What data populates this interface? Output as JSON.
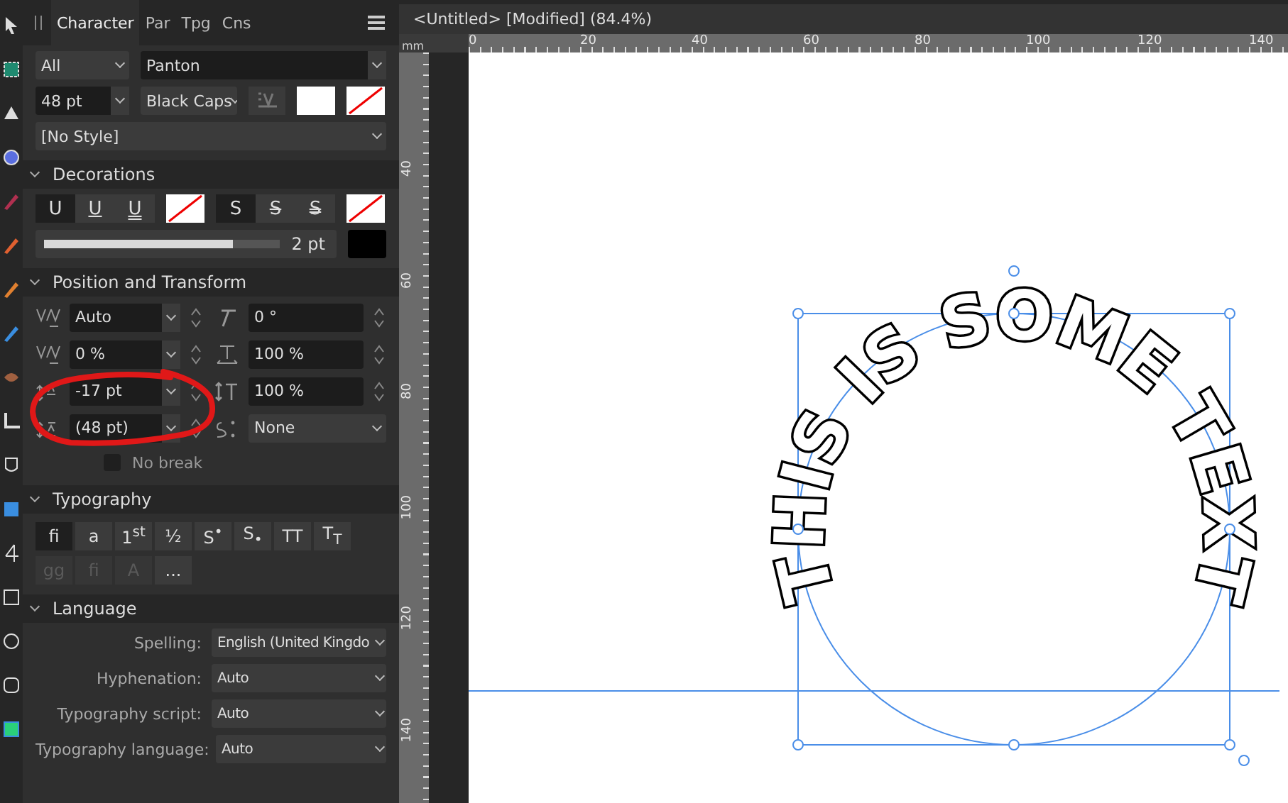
{
  "panel": {
    "tabs": [
      {
        "label": "Character",
        "selected": true
      },
      {
        "label": "Par",
        "selected": false
      },
      {
        "label": "Tpg",
        "selected": false
      },
      {
        "label": "Cns",
        "selected": false
      }
    ],
    "character": {
      "scope": "All",
      "font": "Panton",
      "size": "48 pt",
      "weight": "Black Caps",
      "style": "[No Style]"
    },
    "decorations": {
      "title": "Decorations",
      "underline": [
        {
          "label": "U",
          "kind": "none",
          "selected": true
        },
        {
          "label": "U",
          "kind": "single",
          "selected": false
        },
        {
          "label": "U",
          "kind": "double",
          "selected": false
        }
      ],
      "strike": [
        {
          "label": "S",
          "kind": "none",
          "selected": true
        },
        {
          "label": "S",
          "kind": "single",
          "selected": false
        },
        {
          "label": "S",
          "kind": "double",
          "selected": false
        }
      ],
      "weight": {
        "level": 0.8,
        "reading": "2 pt"
      }
    },
    "position": {
      "title": "Position and Transform",
      "fields": [
        {
          "kind": "kerning",
          "value": "Auto"
        },
        {
          "kind": "shear",
          "value": "0 °"
        },
        {
          "kind": "tracking",
          "value": "0 %"
        },
        {
          "kind": "hscale",
          "value": "100 %"
        },
        {
          "kind": "baseline",
          "value": "-17 pt"
        },
        {
          "kind": "vscale",
          "value": "100 %"
        },
        {
          "kind": "leading",
          "value": "(48 pt)"
        },
        {
          "kind": "script",
          "value": "None"
        }
      ],
      "no_break": {
        "label": "No break",
        "checked": false
      }
    },
    "typography": {
      "title": "Typography",
      "buttons": [
        {
          "label": "fi",
          "selected": true,
          "disabled": false
        },
        {
          "label": "a",
          "selected": false,
          "disabled": false
        },
        {
          "label": "1$^{st}$",
          "selected": false,
          "disabled": false
        },
        {
          "label": "½",
          "selected": false,
          "disabled": false
        },
        {
          "label": "S$^{•}$",
          "selected": false,
          "disabled": false
        },
        {
          "label": "S$_{•}$",
          "selected": false,
          "disabled": false
        },
        {
          "label": "TT",
          "selected": false,
          "disabled": false
        },
        {
          "label": "T$_{T}$",
          "selected": false,
          "disabled": false
        },
        {
          "label": "gg",
          "selected": false,
          "disabled": true
        },
        {
          "label": "fi",
          "selected": false,
          "disabled": true
        },
        {
          "label": "A",
          "selected": false,
          "disabled": true
        },
        {
          "label": "...",
          "selected": false,
          "disabled": false
        }
      ]
    },
    "language": {
      "title": "Language",
      "rows": [
        {
          "label": "Spelling:",
          "value": "English (United Kingdo"
        },
        {
          "label": "Hyphenation:",
          "value": "Auto"
        },
        {
          "label": "Typography script:",
          "value": "Auto"
        },
        {
          "label": "Typography language:",
          "value": "Auto"
        }
      ]
    }
  },
  "document": {
    "title": "<Untitled> [Modified] (84.4%)",
    "unit": "mm",
    "hruler": [
      "0",
      "20",
      "40",
      "60",
      "80",
      "100",
      "120",
      "140"
    ],
    "vruler": [
      "40",
      "60",
      "80",
      "100",
      "120",
      "140"
    ],
    "art_text": "THIS IS SOME TEXT"
  }
}
